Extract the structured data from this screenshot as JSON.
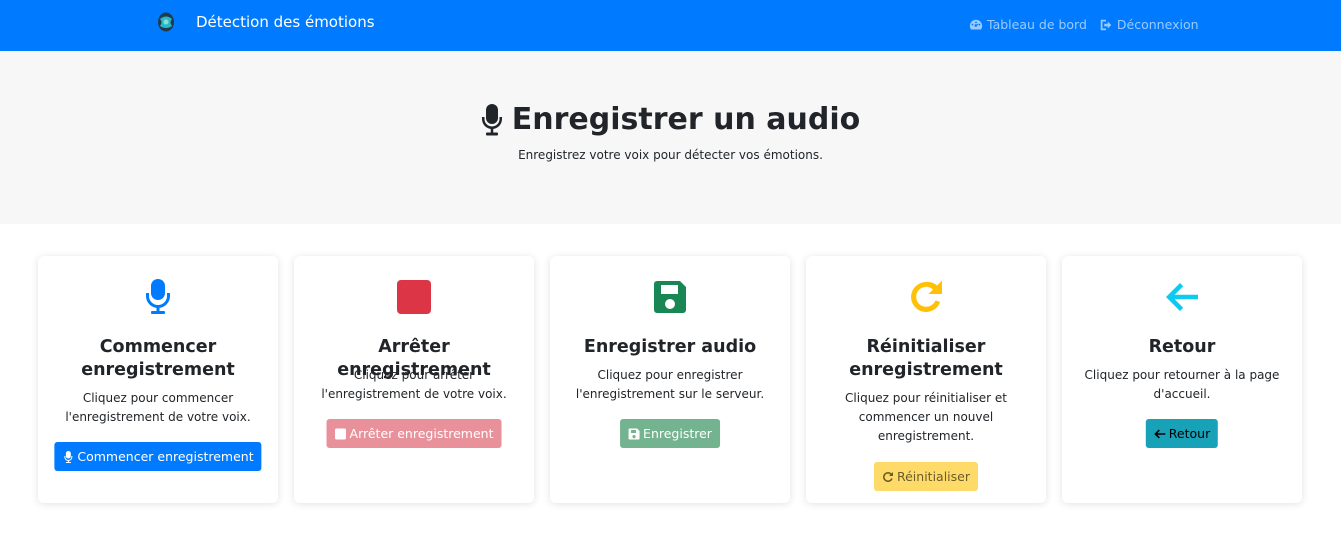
{
  "navbar": {
    "brand": "Détection des émotions",
    "links": [
      {
        "label": "Tableau de bord",
        "icon": "dashboard-gauge-icon"
      },
      {
        "label": "Déconnexion",
        "icon": "sign-out-icon"
      }
    ],
    "color": "#007bff"
  },
  "hero": {
    "title": "Enregistrer un audio",
    "subtitle": "Enregistrez votre voix pour détecter vos émotions.",
    "icon": "microphone-icon"
  },
  "cards": [
    {
      "title": "Commencer enregistrement",
      "text": "Cliquez pour commencer l'enregistrement de votre voix.",
      "button": "Commencer enregistrement",
      "icon": "microphone-icon",
      "color": "#007bff"
    },
    {
      "title": "Arrêter enregistrement",
      "text": "Cliquez pour arrêter l'enregistrement de votre voix.",
      "button": "Arrêter enregistrement",
      "icon": "stop-icon",
      "color": "#dc3545"
    },
    {
      "title": "Enregistrer audio",
      "text": "Cliquez pour enregistrer l'enregistrement sur le serveur.",
      "button": "Enregistrer",
      "icon": "save-icon",
      "color": "#198754"
    },
    {
      "title": "Réinitialiser enregistrement",
      "text": "Cliquez pour réinitialiser et commencer un nouvel enregistrement.",
      "button": "Réinitialiser",
      "icon": "redo-icon",
      "color": "#ffc107"
    },
    {
      "title": "Retour",
      "text": "Cliquez pour retourner à la page d'accueil.",
      "button": "Retour",
      "icon": "arrow-left-icon",
      "color": "#0dcaf0"
    }
  ]
}
